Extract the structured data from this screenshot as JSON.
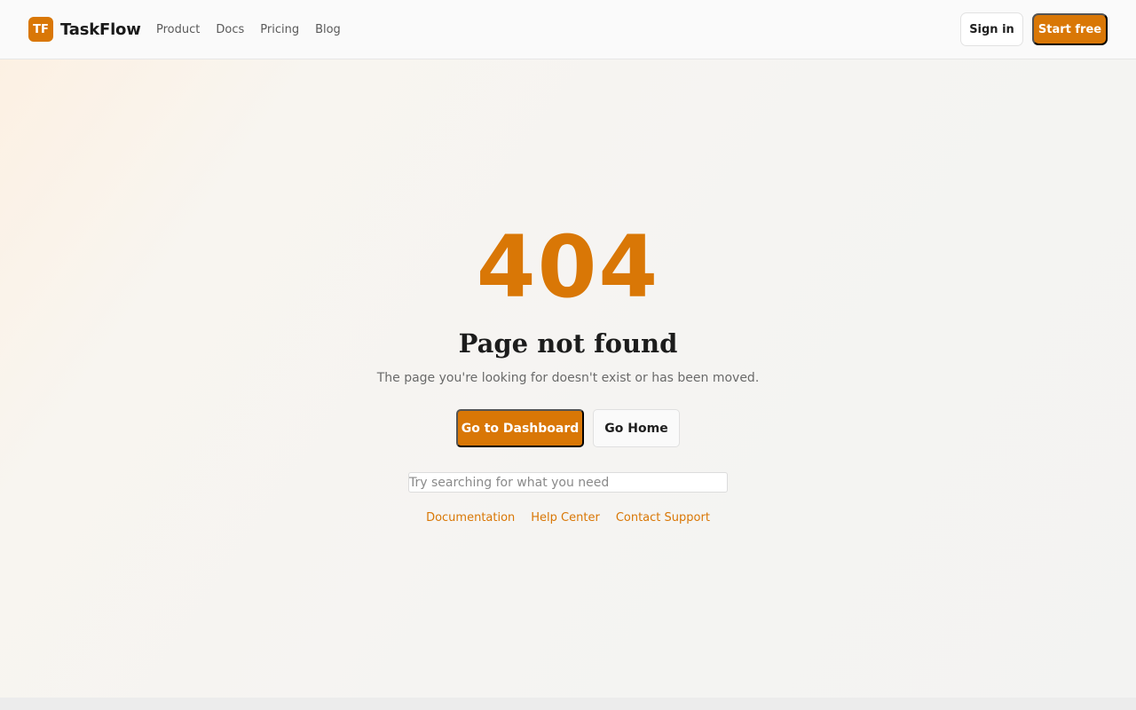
{
  "header": {
    "logo_mark": "TF",
    "brand_name": "TaskFlow",
    "nav": [
      {
        "label": "Product"
      },
      {
        "label": "Docs"
      },
      {
        "label": "Pricing"
      },
      {
        "label": "Blog"
      }
    ],
    "signin_label": "Sign in",
    "start_label": "Start free"
  },
  "main": {
    "code": "404",
    "title": "Page not found",
    "subtitle": "The page you're looking for doesn't exist or has been moved.",
    "primary_button": "Go to Dashboard",
    "secondary_button": "Go Home",
    "search": {
      "value": "",
      "placeholder": "Try searching for what you need"
    },
    "links": [
      {
        "label": "Documentation"
      },
      {
        "label": "Help Center"
      },
      {
        "label": "Contact Support"
      }
    ]
  },
  "colors": {
    "accent": "#d97706",
    "page_background": "#f5f4f2",
    "header_background": "#fafafa"
  }
}
